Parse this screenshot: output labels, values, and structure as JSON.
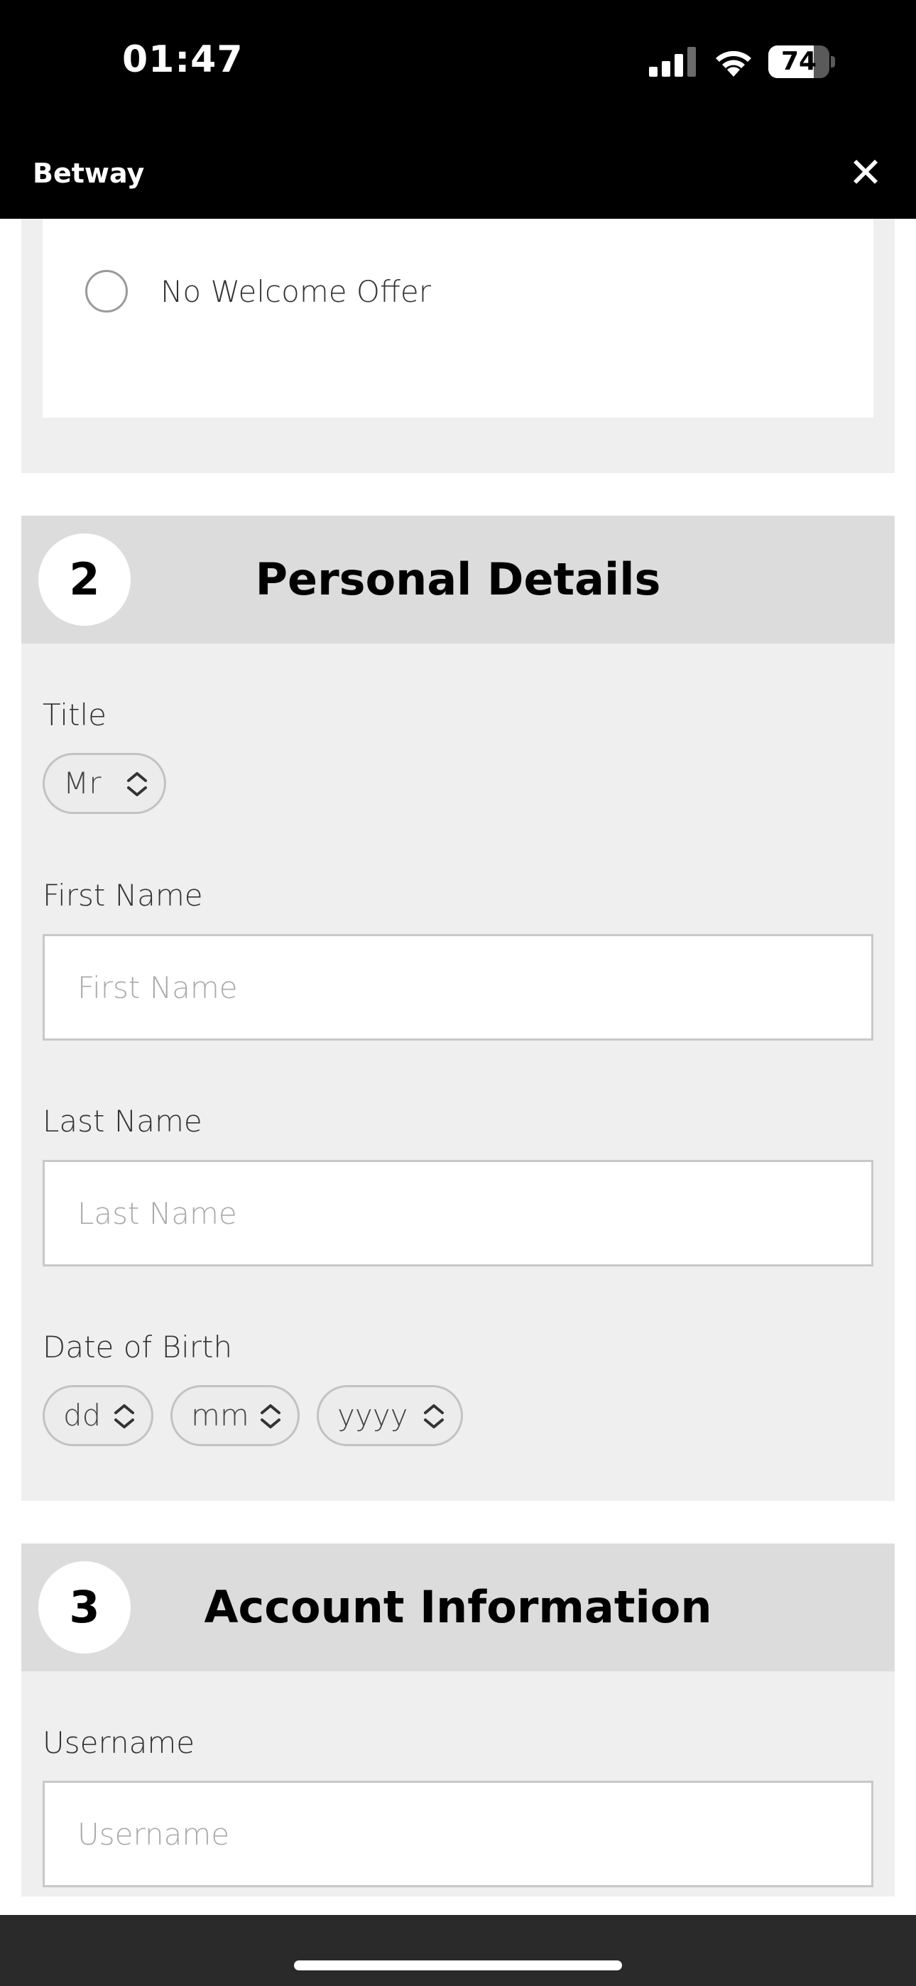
{
  "status_bar": {
    "time": "01:47",
    "battery_level": "74",
    "battery_fraction": 0.74
  },
  "header": {
    "title": "Betway",
    "close_icon": "close-icon"
  },
  "welcome_offer": {
    "option_label": "No Welcome Offer"
  },
  "personal_details": {
    "step": "2",
    "title": "Personal Details",
    "title_label": "Title",
    "title_value": "Mr",
    "first_name_label": "First Name",
    "first_name_placeholder": "First Name",
    "last_name_label": "Last Name",
    "last_name_placeholder": "Last Name",
    "dob_label": "Date of Birth",
    "dob_day": "dd",
    "dob_month": "mm",
    "dob_year": "yyyy"
  },
  "account_information": {
    "step": "3",
    "title": "Account Information",
    "username_label": "Username",
    "username_placeholder": "Username"
  },
  "colors": {
    "header_bg": "#000000",
    "section_bg": "#efefef",
    "section_header_bg": "#dcdcdc"
  }
}
